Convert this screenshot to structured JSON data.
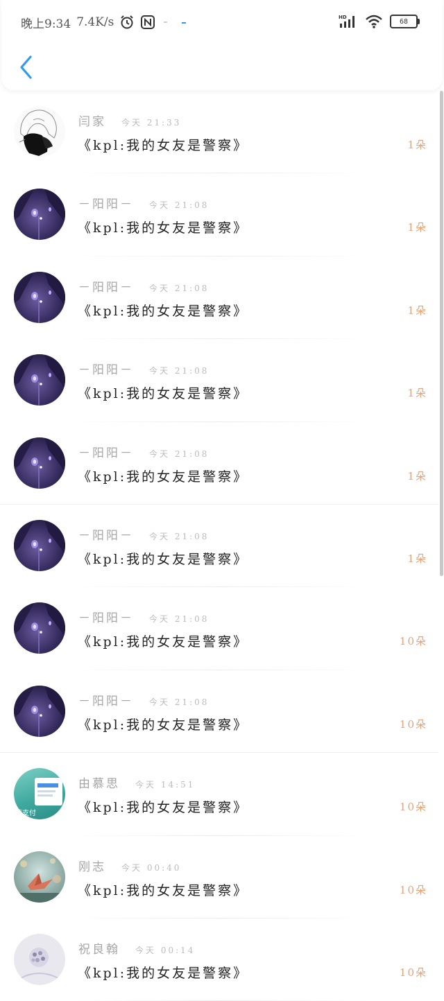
{
  "status_bar": {
    "time": "晚上9:34",
    "speed": "7.4K/s",
    "signal": "HD",
    "battery": "68"
  },
  "header": {
    "back_icon": "chevron-left-icon"
  },
  "colors": {
    "accent": "#2f9bf0",
    "gift_count": "#e3a27a"
  },
  "gift_list": [
    {
      "name": "闫家",
      "time": "今天 21:33",
      "title": "《kpl:我的女友是警察》",
      "count": "1朵",
      "avatar": "sketch-girl"
    },
    {
      "name": "－阳阳－",
      "time": "今天 21:08",
      "title": "《kpl:我的女友是警察》",
      "count": "1朵",
      "avatar": "anime-purple"
    },
    {
      "name": "－阳阳－",
      "time": "今天 21:08",
      "title": "《kpl:我的女友是警察》",
      "count": "1朵",
      "avatar": "anime-purple"
    },
    {
      "name": "－阳阳－",
      "time": "今天 21:08",
      "title": "《kpl:我的女友是警察》",
      "count": "1朵",
      "avatar": "anime-purple"
    },
    {
      "name": "－阳阳－",
      "time": "今天 21:08",
      "title": "《kpl:我的女友是警察》",
      "count": "1朵",
      "avatar": "anime-purple"
    },
    {
      "name": "－阳阳－",
      "time": "今天 21:08",
      "title": "《kpl:我的女友是警察》",
      "count": "1朵",
      "avatar": "anime-purple"
    },
    {
      "name": "－阳阳－",
      "time": "今天 21:08",
      "title": "《kpl:我的女友是警察》",
      "count": "10朵",
      "avatar": "anime-purple"
    },
    {
      "name": "－阳阳－",
      "time": "今天 21:08",
      "title": "《kpl:我的女友是警察》",
      "count": "10朵",
      "avatar": "anime-purple"
    },
    {
      "name": "由慕思",
      "time": "今天 14:51",
      "title": "《kpl:我的女友是警察》",
      "count": "10朵",
      "avatar": "screenshot",
      "avatar_text": "速支付"
    },
    {
      "name": "刚志",
      "time": "今天 00:40",
      "title": "《kpl:我的女友是警察》",
      "count": "10朵",
      "avatar": "paper-crane"
    },
    {
      "name": "祝良翰",
      "time": "今天 00:14",
      "title": "《kpl:我的女友是警察》",
      "count": "10朵",
      "avatar": "lavender"
    }
  ]
}
